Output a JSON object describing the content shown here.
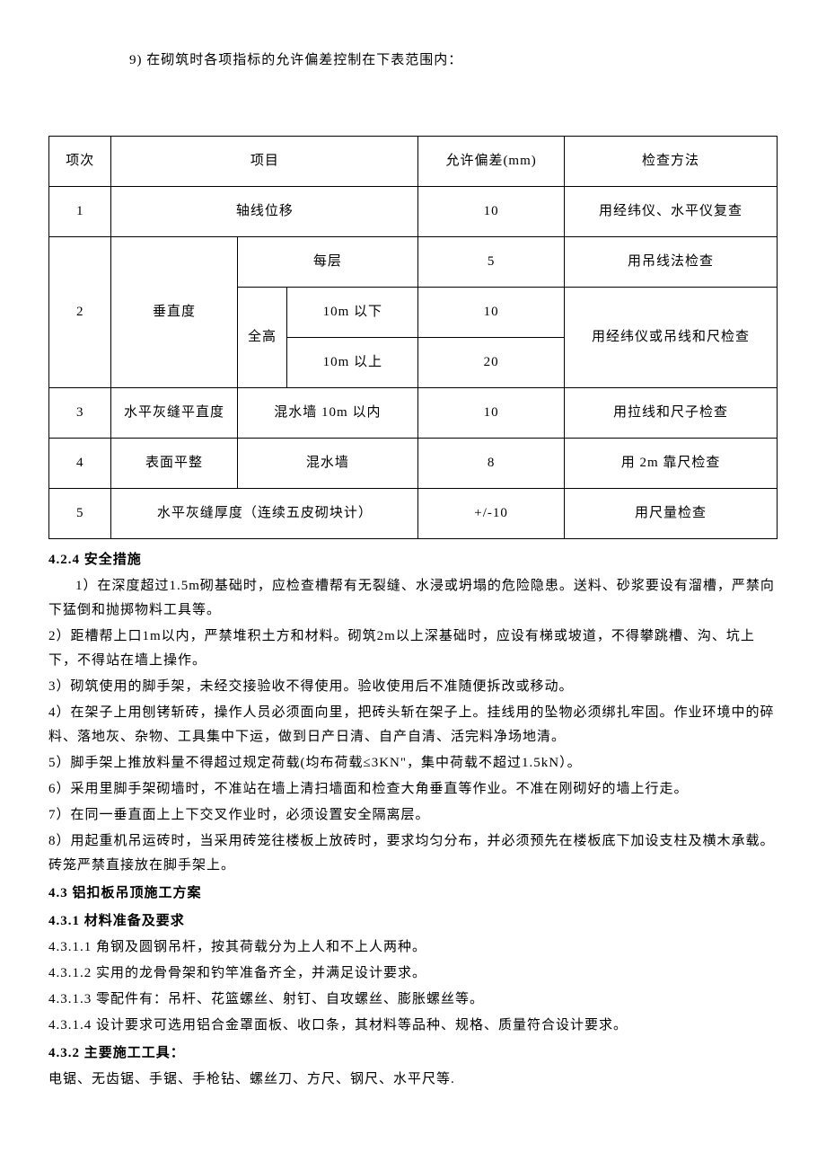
{
  "intro": "9)   在砌筑时各项指标的允许偏差控制在下表范围内：",
  "table": {
    "h_idx": "项次",
    "h_item": "项目",
    "h_dev": "允许偏差(mm)",
    "h_method": "检查方法",
    "r1": {
      "idx": "1",
      "item": "轴线位移",
      "dev": "10",
      "method": "用经纬仪、水平仪复查"
    },
    "r2": {
      "idx": "2",
      "vlabel": "垂直度",
      "each_floor": "每层",
      "each_floor_dev": "5",
      "each_floor_method": "用吊线法检查",
      "full_height": "全高",
      "below": "10m 以下",
      "below_dev": "10",
      "above": "10m 以上",
      "above_dev": "20",
      "height_method": "用经纬仪或吊线和尺检查"
    },
    "r3": {
      "idx": "3",
      "label": "水平灰缝平直度",
      "sub": "混水墙 10m 以内",
      "dev": "10",
      "method": "用拉线和尺子检查"
    },
    "r4": {
      "idx": "4",
      "label": "表面平整",
      "sub": "混水墙",
      "dev": "8",
      "method": "用 2m 靠尺检查"
    },
    "r5": {
      "idx": "5",
      "label": "水平灰缝厚度（连续五皮砌块计）",
      "dev": "+/-10",
      "method": "用尺量检查"
    }
  },
  "s424": {
    "title": "4.2.4 安全措施",
    "p1": "1）在深度超过1.5m砌基础时，应检查槽帮有无裂缝、水浸或坍塌的危险隐患。送料、砂浆要设有溜槽，严禁向下猛倒和抛掷物料工具等。",
    "p2": "2）距槽帮上口1m以内，严禁堆积土方和材料。砌筑2m以上深基础时，应设有梯或坡道，不得攀跳槽、沟、坑上下，不得站在墙上操作。",
    "p3": "3）砌筑使用的脚手架，未经交接验收不得使用。验收使用后不准随便拆改或移动。",
    "p4": "4）在架子上用刨铐斩砖，操作人员必须面向里，把砖头斩在架子上。挂线用的坠物必须绑扎牢固。作业环境中的碎料、落地灰、杂物、工具集中下运，做到日产日清、自产自清、活完料净场地清。",
    "p5": "5）脚手架上推放料量不得超过规定荷载(均布荷载≤3KN\"，集中荷载不超过1.5kN）。",
    "p6": "6）采用里脚手架砌墙时，不准站在墙上清扫墙面和检查大角垂直等作业。不准在刚砌好的墙上行走。",
    "p7": "7）在同一垂直面上上下交叉作业时，必须设置安全隔离层。",
    "p8": "8）用起重机吊运砖时，当采用砖笼往楼板上放砖时，要求均匀分布，并必须预先在楼板底下加设支柱及横木承载。砖笼严禁直接放在脚手架上。"
  },
  "s43": {
    "title": "4.3 铝扣板吊顶施工方案"
  },
  "s431": {
    "title": "4.3.1 材料准备及要求",
    "p1": "4.3.1.1 角钢及圆钢吊杆，按其荷载分为上人和不上人两种。",
    "p2": "4.3.1.2 实用的龙骨骨架和钓竿准备齐全，并满足设计要求。",
    "p3": "4.3.1.3 零配件有：吊杆、花篮螺丝、射钉、自攻螺丝、膨胀螺丝等。",
    "p4": "4.3.1.4 设计要求可选用铝合金罩面板、收口条，其材料等品种、规格、质量符合设计要求。"
  },
  "s432": {
    "title": "4.3.2 主要施工工具：",
    "p1": "电锯、无齿锯、手锯、手枪钻、螺丝刀、方尺、钢尺、水平尺等."
  }
}
